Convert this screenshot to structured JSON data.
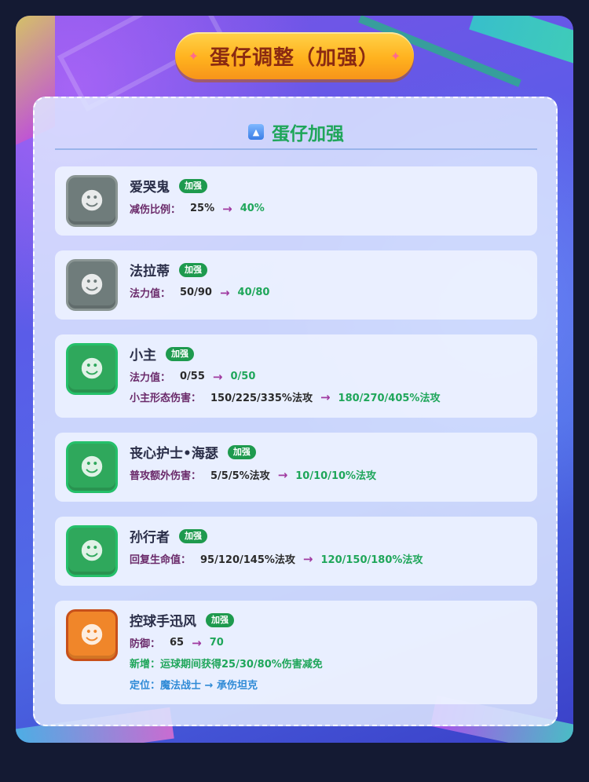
{
  "header": {
    "title": "蛋仔调整（加强）",
    "star_left": "✦",
    "star_right": "✦"
  },
  "section": {
    "icon": "up-triangle-icon",
    "title": "蛋仔加强"
  },
  "heroes": [
    {
      "name": "爱哭鬼",
      "badge": "加强",
      "avatar_color": "grey",
      "stats": [
        {
          "label": "减伤比例：",
          "old": "25%",
          "arrow": "→",
          "new": "40%"
        }
      ]
    },
    {
      "name": "法拉蒂",
      "badge": "加强",
      "avatar_color": "grey",
      "stats": [
        {
          "label": "法力值：",
          "old": "50/90",
          "arrow": "→",
          "new": "40/80"
        }
      ]
    },
    {
      "name": "小主",
      "badge": "加强",
      "avatar_color": "green",
      "stats": [
        {
          "label": "法力值：",
          "old": "0/55",
          "arrow": "→",
          "new": "0/50"
        },
        {
          "label": "小主形态伤害：",
          "old": "150/225/335%法攻",
          "arrow": "→",
          "new": "180/270/405%法攻"
        }
      ]
    },
    {
      "name": "丧心护士•海瑟",
      "badge": "加强",
      "avatar_color": "green",
      "stats": [
        {
          "label": "普攻额外伤害：",
          "old": "5/5/5%法攻",
          "arrow": "→",
          "new": "10/10/10%法攻"
        }
      ]
    },
    {
      "name": "孙行者",
      "badge": "加强",
      "avatar_color": "green",
      "stats": [
        {
          "label": "回复生命值：",
          "old": "95/120/145%法攻",
          "arrow": "→",
          "new": "120/150/180%法攻"
        }
      ]
    },
    {
      "name": "控球手迅风",
      "badge": "加强",
      "avatar_color": "orange",
      "stats": [
        {
          "label": "防御：",
          "old": "65",
          "arrow": "→",
          "new": "70"
        }
      ],
      "notes": [
        "新增：运球期间获得25/30/80%伤害减免",
        "定位：魔法战士 → 承伤坦克"
      ]
    }
  ],
  "colors": {
    "accent_green": "#1fa65a",
    "title_orange": "#ffb21e",
    "panel_bg": "#dee8ff"
  }
}
